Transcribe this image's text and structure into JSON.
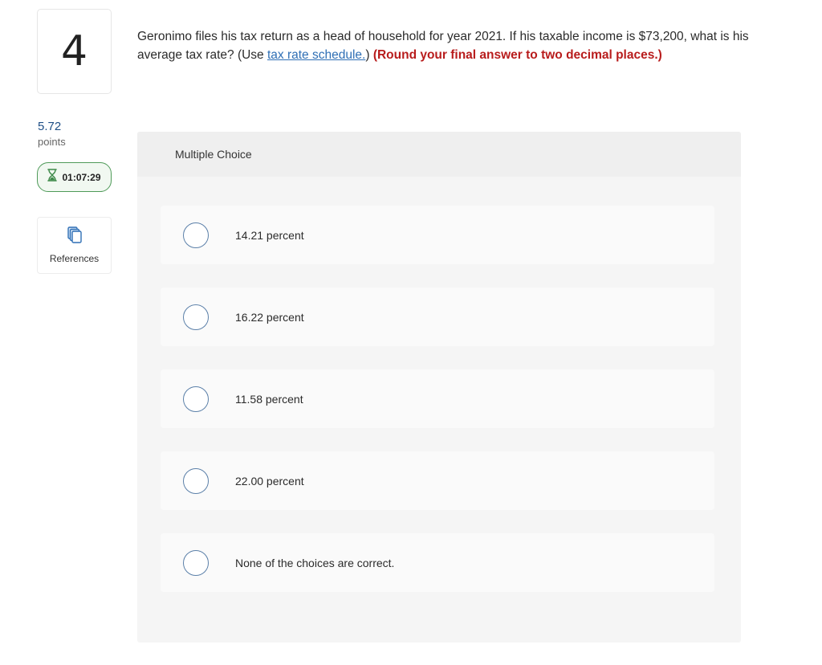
{
  "question": {
    "number": "4",
    "points_value": "5.72",
    "points_label": "points",
    "timer": "01:07:29",
    "references_label": "References",
    "text_before_link": "Geronimo files his tax return as a head of household for year 2021. If his taxable income is $73,200, what is his average tax rate? (Use ",
    "link_text": "tax rate schedule.",
    "text_after_link": ") ",
    "instruction": "(Round your final answer to two decimal places.)"
  },
  "multiple_choice": {
    "header": "Multiple Choice",
    "options": [
      {
        "label": "14.21 percent",
        "selected": false
      },
      {
        "label": "16.22 percent",
        "selected": false
      },
      {
        "label": "11.58 percent",
        "selected": false
      },
      {
        "label": "22.00 percent",
        "selected": false
      },
      {
        "label": "None of the choices are correct.",
        "selected": false
      }
    ]
  },
  "colors": {
    "points": "#1f4f86",
    "timer_border": "#4f9a59",
    "link": "#2f6fb5",
    "instruction": "#b81c1c",
    "radio_border": "#5a7fa8"
  }
}
